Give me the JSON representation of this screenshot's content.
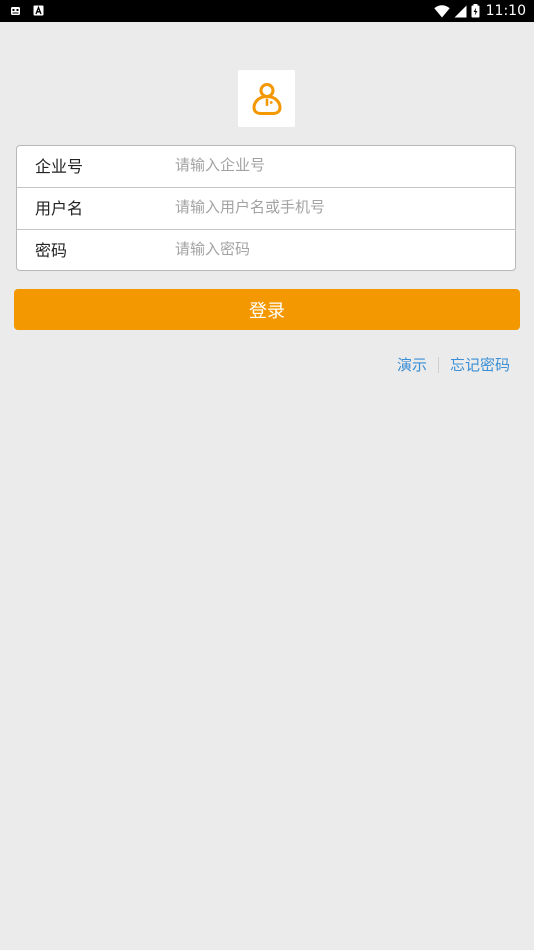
{
  "status_bar": {
    "time": "11:10",
    "left_icons": [
      "android-debug-icon",
      "notification-a-icon"
    ],
    "right_icons": [
      "wifi-icon",
      "cellular-signal-icon",
      "battery-icon"
    ]
  },
  "logo": {
    "icon": "user-profile-icon",
    "color": "#f39800"
  },
  "form": {
    "fields": [
      {
        "label": "企业号",
        "placeholder": "请输入企业号",
        "value": ""
      },
      {
        "label": "用户名",
        "placeholder": "请输入用户名或手机号",
        "value": ""
      },
      {
        "label": "密码",
        "placeholder": "请输入密码",
        "value": ""
      }
    ]
  },
  "login": {
    "label": "登录",
    "color": "#f39800"
  },
  "links": {
    "demo": "演示",
    "forgot_password": "忘记密码",
    "color": "#3a8fd6"
  }
}
